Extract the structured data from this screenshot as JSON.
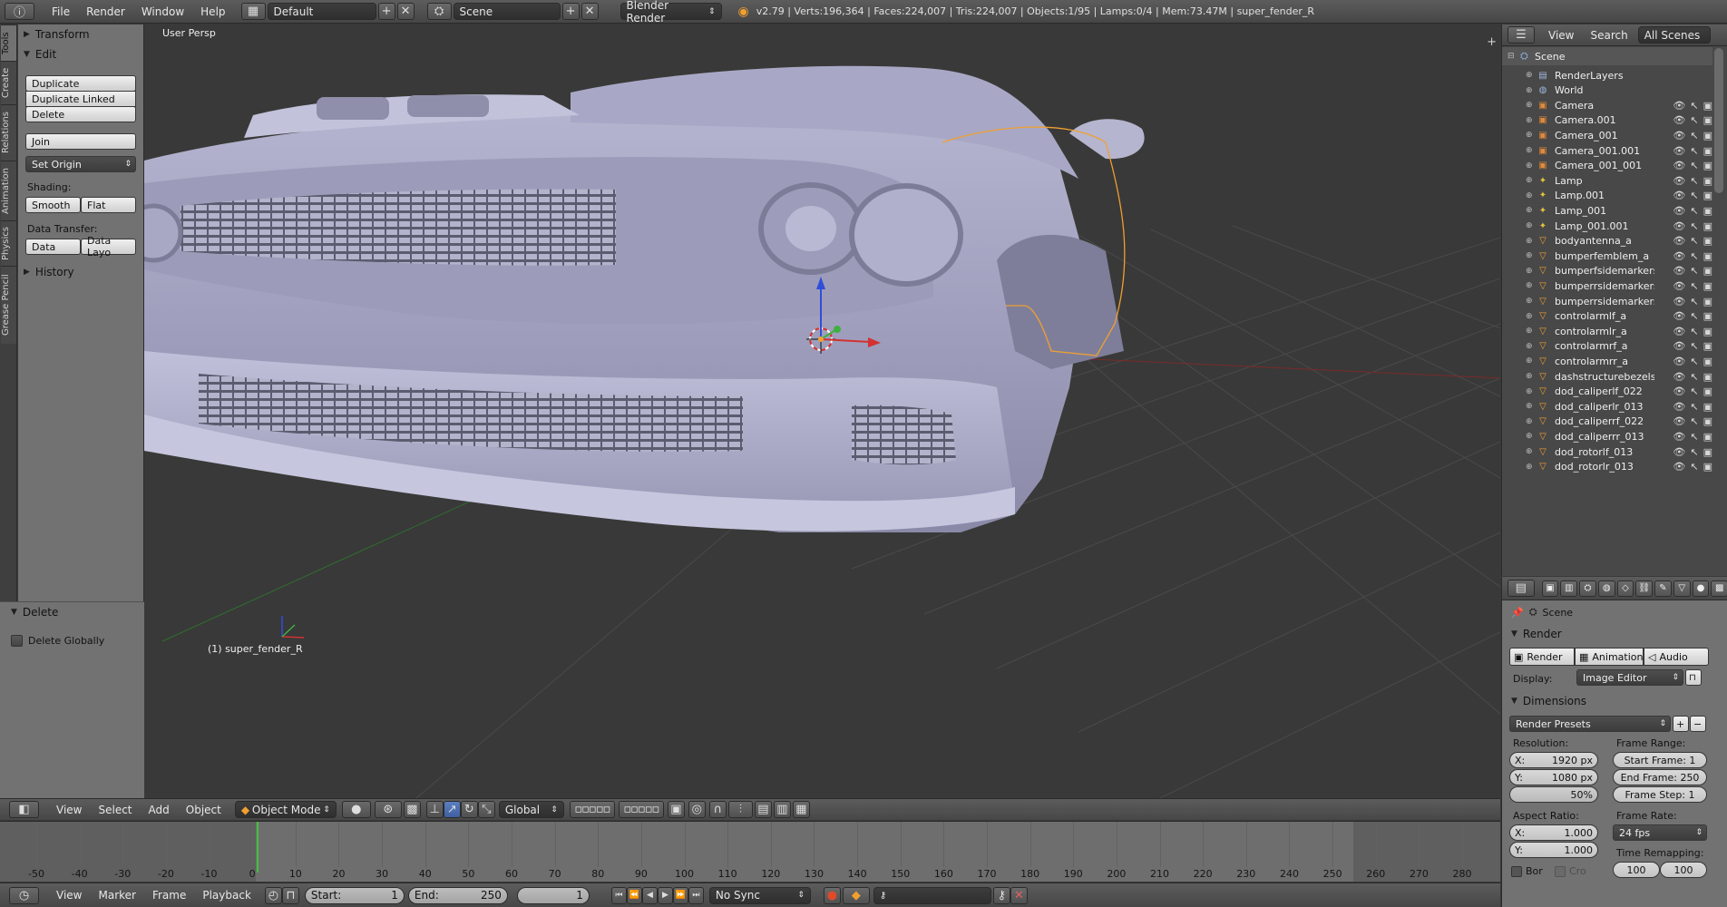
{
  "topbar": {
    "menus": [
      "File",
      "Render",
      "Window",
      "Help"
    ],
    "layout": "Default",
    "scene": "Scene",
    "engine": "Blender Render",
    "stats": "v2.79 | Verts:196,364 | Faces:224,007 | Tris:224,007 | Objects:1/95 | Lamps:0/4 | Mem:73.47M | super_fender_R"
  },
  "tool_tabs": [
    "Tools",
    "Create",
    "Relations",
    "Animation",
    "Physics",
    "Grease Pencil"
  ],
  "tools": {
    "transform": "Transform",
    "edit": "Edit",
    "duplicate": "Duplicate",
    "duplicate_linked": "Duplicate Linked",
    "delete": "Delete",
    "join": "Join",
    "set_origin": "Set Origin",
    "shading_label": "Shading:",
    "smooth": "Smooth",
    "flat": "Flat",
    "data_transfer_label": "Data Transfer:",
    "data": "Data",
    "data_layout": "Data Layo",
    "history": "History"
  },
  "operator_panel": {
    "title": "Delete",
    "delete_globally": "Delete Globally",
    "delete_globally_checked": false
  },
  "viewport": {
    "view_name": "User Persp",
    "object_label": "(1) super_fender_R"
  },
  "viewport_header": {
    "menus": [
      "View",
      "Select",
      "Add",
      "Object"
    ],
    "mode": "Object Mode",
    "orientation": "Global"
  },
  "timeline": {
    "ticks": [
      -50,
      -40,
      -30,
      -20,
      -10,
      0,
      10,
      20,
      30,
      40,
      50,
      60,
      70,
      80,
      90,
      100,
      110,
      120,
      130,
      140,
      150,
      160,
      170,
      180,
      190,
      200,
      210,
      220,
      230,
      240,
      250,
      260,
      270,
      280
    ],
    "current_frame": 1,
    "start": "1",
    "end": "250",
    "start_label": "Start:",
    "end_label": "End:",
    "sync": "No Sync",
    "menus": [
      "View",
      "Marker",
      "Frame",
      "Playback"
    ]
  },
  "outliner": {
    "menus": [
      "View",
      "Search"
    ],
    "filter": "All Scenes",
    "scene": "Scene",
    "items": [
      {
        "name": "RenderLayers",
        "type": "renderlayers"
      },
      {
        "name": "World",
        "type": "world"
      },
      {
        "name": "Camera",
        "type": "camera"
      },
      {
        "name": "Camera.001",
        "type": "camera"
      },
      {
        "name": "Camera_001",
        "type": "camera"
      },
      {
        "name": "Camera_001.001",
        "type": "camera"
      },
      {
        "name": "Camera_001_001",
        "type": "camera"
      },
      {
        "name": "Lamp",
        "type": "lamp"
      },
      {
        "name": "Lamp.001",
        "type": "lamp"
      },
      {
        "name": "Lamp_001",
        "type": "lamp"
      },
      {
        "name": "Lamp_001.001",
        "type": "lamp"
      },
      {
        "name": "bodyantenna_a",
        "type": "mesh"
      },
      {
        "name": "bumperfemblem_a",
        "type": "mesh"
      },
      {
        "name": "bumperfsidemarkers_a",
        "type": "mesh"
      },
      {
        "name": "bumperrsidemarkers_a",
        "type": "mesh"
      },
      {
        "name": "bumperrsidemarkersbi",
        "type": "mesh"
      },
      {
        "name": "controlarmlf_a",
        "type": "mesh"
      },
      {
        "name": "controlarmlr_a",
        "type": "mesh"
      },
      {
        "name": "controlarmrf_a",
        "type": "mesh"
      },
      {
        "name": "controlarmrr_a",
        "type": "mesh"
      },
      {
        "name": "dashstructurebezels_a",
        "type": "mesh"
      },
      {
        "name": "dod_caliperlf_022",
        "type": "mesh"
      },
      {
        "name": "dod_caliperlr_013",
        "type": "mesh"
      },
      {
        "name": "dod_caliperrf_022",
        "type": "mesh"
      },
      {
        "name": "dod_caliperrr_013",
        "type": "mesh"
      },
      {
        "name": "dod_rotorlf_013",
        "type": "mesh"
      },
      {
        "name": "dod_rotorlr_013",
        "type": "mesh"
      }
    ]
  },
  "properties": {
    "context": "Scene",
    "render_panel": "Render",
    "render_btn": "Render",
    "animation_btn": "Animation",
    "audio_btn": "Audio",
    "display_label": "Display:",
    "display": "Image Editor",
    "dimensions_panel": "Dimensions",
    "presets": "Render Presets",
    "resolution_label": "Resolution:",
    "res_x": "1920 px",
    "res_y": "1080 px",
    "res_pct": "50%",
    "x_label": "X:",
    "y_label": "Y:",
    "frame_range_label": "Frame Range:",
    "start_frame": "Start Frame: 1",
    "end_frame": "End Frame: 250",
    "frame_step": "Frame Step: 1",
    "aspect_label": "Aspect Ratio:",
    "aspect_x": "1.000",
    "aspect_y": "1.000",
    "frame_rate_label": "Frame Rate:",
    "fps": "24 fps",
    "time_remap_label": "Time Remapping:",
    "remap_old": "100",
    "remap_new": "100",
    "border_label": "Bor",
    "crop_label": "Cro"
  },
  "colors": {
    "selection_outline": "#f0a030",
    "x_axis": "#d23232",
    "y_axis": "#3fb03f",
    "z_axis": "#2f4fd8",
    "car_body": "#a3a3c2"
  }
}
